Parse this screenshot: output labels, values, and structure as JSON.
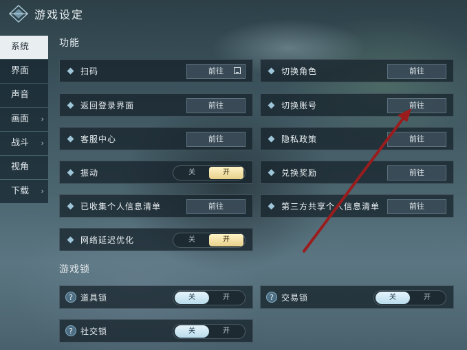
{
  "title": "游戏设定",
  "sidebar": {
    "items": [
      {
        "label": "系统",
        "chev": ""
      },
      {
        "label": "界面",
        "chev": ""
      },
      {
        "label": "声音",
        "chev": ""
      },
      {
        "label": "画面",
        "chev": "›"
      },
      {
        "label": "战斗",
        "chev": "›"
      },
      {
        "label": "视角",
        "chev": ""
      },
      {
        "label": "下载",
        "chev": "›"
      }
    ]
  },
  "sections": {
    "functions": "功能",
    "game_lock": "游戏锁"
  },
  "goto_label": "前往",
  "toggle": {
    "off": "关",
    "on": "开"
  },
  "rows": {
    "scan": "扫码",
    "switch_role": "切换角色",
    "return_login": "返回登录界面",
    "switch_account": "切换账号",
    "customer_service": "客服中心",
    "privacy": "隐私政策",
    "vibration": "振动",
    "redeem": "兑换奖励",
    "personal_info": "已收集个人信息清单",
    "third_party": "第三方共享个人信息清单",
    "network": "网络延迟优化",
    "item_lock": "道具锁",
    "trade_lock": "交易锁",
    "social_lock": "社交锁"
  },
  "states": {
    "vibration": "开",
    "network": "开",
    "item_lock": "关",
    "trade_lock": "关",
    "social_lock": "关"
  },
  "colors": {
    "active_tab": "#e9eef0",
    "toggle_on_gold": "#e8d08a",
    "toggle_on_blue": "#b9dcec",
    "annotation_arrow": "#9b1c1c"
  }
}
